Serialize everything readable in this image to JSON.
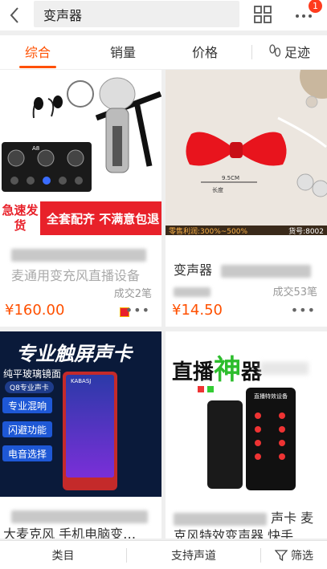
{
  "header": {
    "search_text": "变声器",
    "badge_count": "1",
    "back_icon": "chevron-left-icon",
    "grid_icon": "grid-view-icon",
    "more_icon": "more-dots-icon"
  },
  "tabs": {
    "items": [
      {
        "label": "综合",
        "active": true
      },
      {
        "label": "销量",
        "active": false
      },
      {
        "label": "价格",
        "active": false
      },
      {
        "label": "足迹",
        "active": false,
        "icon": "footprint-icon"
      }
    ]
  },
  "products": [
    {
      "banner_left": "急速发货",
      "banner_right": "全套配齐 不满意包退",
      "device_label": "A8",
      "title_line2": "麦通用变充风直播设备",
      "sales": "成交2笔",
      "price": "¥160.00"
    },
    {
      "overlay_left": "零售利润:300%~500%",
      "overlay_right": "货号:8002",
      "size_label": "9.5CM",
      "size_tag": "长度",
      "title_prefix": "变声器",
      "sales": "成交53笔",
      "price": "¥14.50"
    },
    {
      "headline": "专业触屏声卡",
      "subline": "纯平玻璃镜面",
      "badge_text": "Q8专业声卡",
      "brand": "KABASJ",
      "features": [
        "专业混响",
        "闪避功能",
        "电音选择"
      ],
      "title_line2": "大麦克风 手机电脑变…"
    },
    {
      "headline_a": "直播",
      "headline_b": "神",
      "headline_c": "器",
      "device_caption": "直播特效设备",
      "title_suffix": "声卡 麦",
      "title_line2": "克风特效变声器 快手…"
    }
  ],
  "bottom_bar": {
    "category": "类目",
    "support": "支持声道",
    "filter": "筛选"
  },
  "colors": {
    "accent": "#ff5000",
    "badge": "#ff3b1d"
  }
}
